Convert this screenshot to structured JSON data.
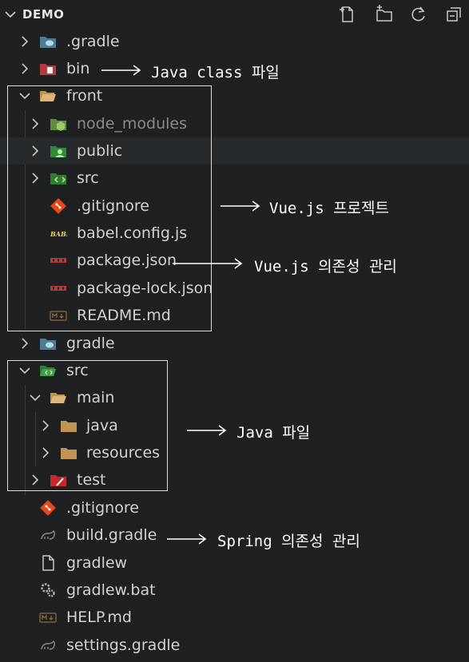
{
  "explorer": {
    "title": "DEMO",
    "actions": [
      "new-file-icon",
      "new-folder-icon",
      "refresh-icon",
      "collapse-all-icon"
    ]
  },
  "tree": [
    {
      "label": ".gradle",
      "icon": "gradle-folder-icon",
      "chevron": "right"
    },
    {
      "label": "bin",
      "icon": "bin-folder-icon",
      "chevron": "right"
    },
    {
      "label": "front",
      "icon": "folder-open-icon",
      "chevron": "down"
    },
    {
      "label": "node_modules",
      "icon": "node-folder-icon",
      "chevron": "right"
    },
    {
      "label": "public",
      "icon": "public-folder-icon",
      "chevron": "right"
    },
    {
      "label": "src",
      "icon": "src-folder-icon",
      "chevron": "right"
    },
    {
      "label": ".gitignore",
      "icon": "git-icon"
    },
    {
      "label": "babel.config.js",
      "icon": "babel-icon"
    },
    {
      "label": "package.json",
      "icon": "npm-icon"
    },
    {
      "label": "package-lock.json",
      "icon": "npm-icon"
    },
    {
      "label": "README.md",
      "icon": "markdown-icon"
    },
    {
      "label": "gradle",
      "icon": "gradle-folder-icon",
      "chevron": "right"
    },
    {
      "label": "src",
      "icon": "src-folder-open-icon",
      "chevron": "down"
    },
    {
      "label": "main",
      "icon": "folder-open-icon",
      "chevron": "down"
    },
    {
      "label": "java",
      "icon": "folder-icon",
      "chevron": "right"
    },
    {
      "label": "resources",
      "icon": "folder-icon",
      "chevron": "right"
    },
    {
      "label": "test",
      "icon": "test-folder-icon",
      "chevron": "right"
    },
    {
      "label": ".gitignore",
      "icon": "git-icon"
    },
    {
      "label": "build.gradle",
      "icon": "gradle-icon"
    },
    {
      "label": "gradlew",
      "icon": "file-icon"
    },
    {
      "label": "gradlew.bat",
      "icon": "gear-icon"
    },
    {
      "label": "HELP.md",
      "icon": "markdown-icon"
    },
    {
      "label": "settings.gradle",
      "icon": "gradle-icon"
    }
  ],
  "annotations": {
    "bin": "Java class 파일",
    "vue": "Vue.js 프로젝트",
    "vue_deps": "Vue.js 의존성 관리",
    "java": "Java 파일",
    "spring_deps": "Spring 의존성 관리"
  }
}
